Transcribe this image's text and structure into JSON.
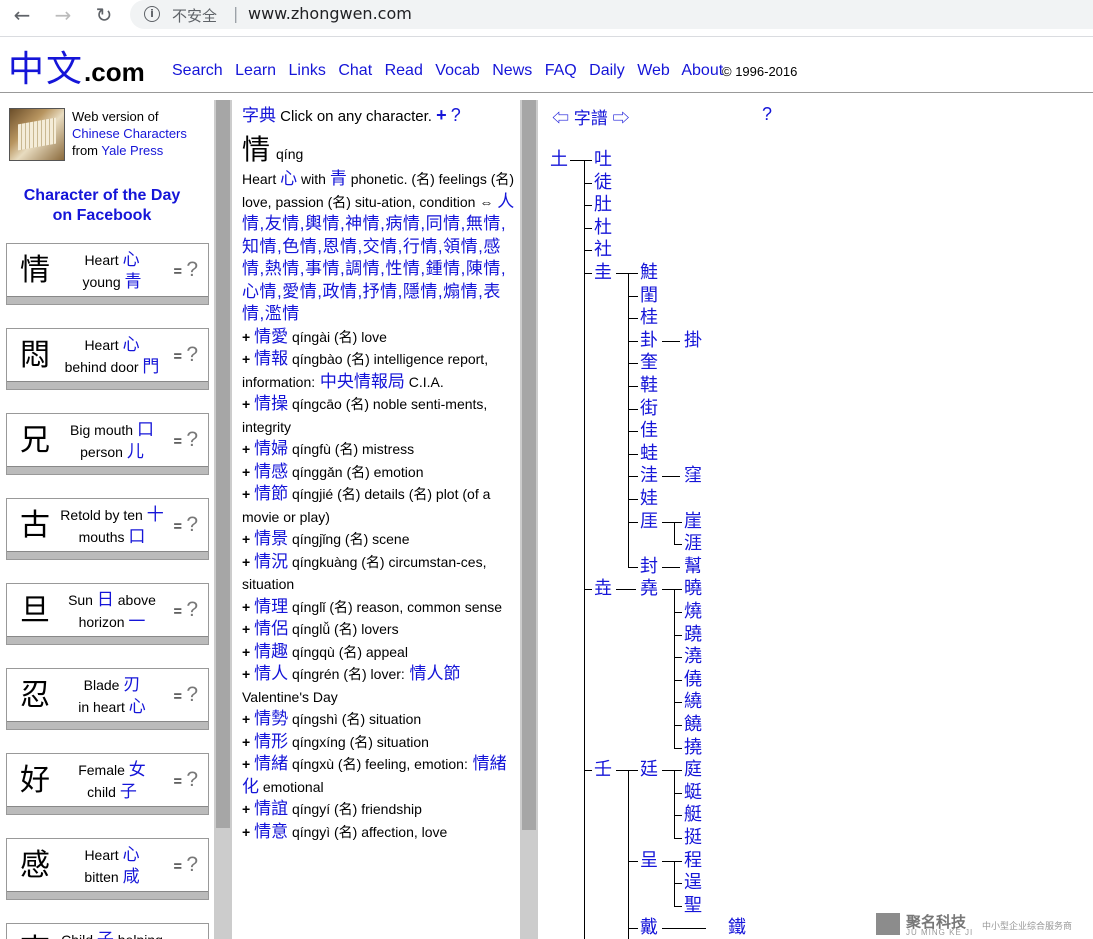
{
  "browser": {
    "back_icon": "arrow-left-icon",
    "forward_icon": "arrow-right-icon",
    "reload_icon": "reload-icon",
    "security_label": "不安全",
    "url": "www.zhongwen.com"
  },
  "header": {
    "logo_chinese": "中文",
    "logo_suffix": ".com",
    "nav": [
      "Search",
      "Learn",
      "Links",
      "Chat",
      "Read",
      "Vocab",
      "News",
      "FAQ",
      "Daily",
      "Web",
      "About"
    ],
    "copyright": "© 1996-2016"
  },
  "left": {
    "book_line1": "Web version of",
    "book_line2": "Chinese Characters",
    "book_line3_prefix": "from",
    "book_line3_link": "Yale Press",
    "cotd_line1": "Character of the Day",
    "cotd_line2": "on Facebook",
    "cards": [
      {
        "char": "情",
        "l1": "Heart",
        "c1": "心",
        "l2": "young",
        "c2": "青"
      },
      {
        "char": "悶",
        "l1": "Heart",
        "c1": "心",
        "l2": "behind door",
        "c2": "門"
      },
      {
        "char": "兄",
        "l1": "Big mouth",
        "c1": "口",
        "l2": "person",
        "c2": "儿"
      },
      {
        "char": "古",
        "l1": "Retold by ten",
        "c1": "十",
        "l2": "mouths",
        "c2": "口"
      },
      {
        "char": "旦",
        "l1": "Sun",
        "c1": "日",
        "l1b": "above",
        "l2": "horizon",
        "c2": "一"
      },
      {
        "char": "忍",
        "l1": "Blade",
        "c1": "刃",
        "l2": "in heart",
        "c2": "心"
      },
      {
        "char": "好",
        "l1": "Female",
        "c1": "女",
        "l2": "child",
        "c2": "子"
      },
      {
        "char": "感",
        "l1": "Heart",
        "c1": "心",
        "l2": "bitten",
        "c2": "咸"
      },
      {
        "char": "李",
        "l1": "Child",
        "c1": "子",
        "l1b": "helping",
        "l2": "",
        "c2": ""
      }
    ],
    "eq": "=",
    "q": "?"
  },
  "dict": {
    "title": "字典",
    "instruction": "Click on any character.",
    "plus": "+",
    "help": "?",
    "head_char": "情",
    "head_pinyin": "qíng",
    "def": [
      {
        "t": "Heart "
      },
      {
        "c": "心"
      },
      {
        "t": " with "
      },
      {
        "c": "青"
      },
      {
        "t": " phonetic. (名) feelings (名) love, passion (名) situ-ation, condition ⇔ "
      }
    ],
    "compounds_line": "人情,友情,輿情,神情,病情,同情,無情,知情,色情,恩情,交情,行情,領情,感情,熱情,事情,調情,性情,鍾情,陳情,心情,愛情,政情,抒情,隱情,煽情,表情,濫情",
    "entries": [
      {
        "w": "情愛",
        "py": "qíngài",
        "d": "(名) love"
      },
      {
        "w": "情報",
        "py": "qíngbào",
        "d": "(名) intelligence report, information:",
        "x": "中央情報局",
        "d2": "C.I.A."
      },
      {
        "w": "情操",
        "py": "qíngcāo",
        "d": "(名) noble senti-ments, integrity"
      },
      {
        "w": "情婦",
        "py": "qíngfù",
        "d": "(名) mistress"
      },
      {
        "w": "情感",
        "py": "qínggǎn",
        "d": "(名) emotion"
      },
      {
        "w": "情節",
        "py": "qíngjié",
        "d": "(名) details (名) plot (of a movie or play)"
      },
      {
        "w": "情景",
        "py": "qíngjǐng",
        "d": "(名) scene"
      },
      {
        "w": "情況",
        "py": "qíngkuàng",
        "d": "(名) circumstan-ces, situation"
      },
      {
        "w": "情理",
        "py": "qínglǐ",
        "d": "(名) reason, common sense"
      },
      {
        "w": "情侶",
        "py": "qínglǚ",
        "d": "(名) lovers"
      },
      {
        "w": "情趣",
        "py": "qíngqù",
        "d": "(名) appeal"
      },
      {
        "w": "情人",
        "py": "qíngrén",
        "d": "(名) lover:",
        "x": "情人節",
        "d2": "Valentine's Day"
      },
      {
        "w": "情勢",
        "py": "qíngshì",
        "d": "(名) situation"
      },
      {
        "w": "情形",
        "py": "qíngxíng",
        "d": "(名) situation"
      },
      {
        "w": "情緒",
        "py": "qíngxù",
        "d": "(名) feeling, emotion:",
        "x": "情緒化",
        "d2": "emotional"
      },
      {
        "w": "情誼",
        "py": "qíngyí",
        "d": "(名) friendship"
      },
      {
        "w": "情意",
        "py": "qíngyì",
        "d": "(名) affection, love"
      }
    ]
  },
  "tree": {
    "title": "⇦ 字譜 ⇨",
    "help": "?",
    "root": "土",
    "level1": [
      "吐",
      "徒",
      "肚",
      "杜",
      "社",
      "圭",
      "垚",
      "壬"
    ],
    "gui_children": [
      "鮭",
      "閨",
      "桂",
      "卦",
      "奎",
      "鞋",
      "街",
      "佳",
      "蛙",
      "洼",
      "娃",
      "厓",
      "封"
    ],
    "gua_child": "掛",
    "wa_child": "窪",
    "ya_children": [
      "崖",
      "涯"
    ],
    "feng_child": "幫",
    "yao_child": "堯",
    "yao_children": [
      "曉",
      "燒",
      "蹺",
      "澆",
      "僥",
      "繞",
      "饒",
      "撓"
    ],
    "ren_children": [
      "廷",
      "呈",
      "戴"
    ],
    "ting_children": [
      "庭",
      "蜓",
      "艇",
      "挺"
    ],
    "cheng_children": [
      "程",
      "逞",
      "聖"
    ],
    "dai_child": "鐵"
  },
  "watermark": {
    "brand": "聚名科技",
    "brand_en": "JU MING KE JI",
    "tagline": "中小型企业综合服务商"
  }
}
